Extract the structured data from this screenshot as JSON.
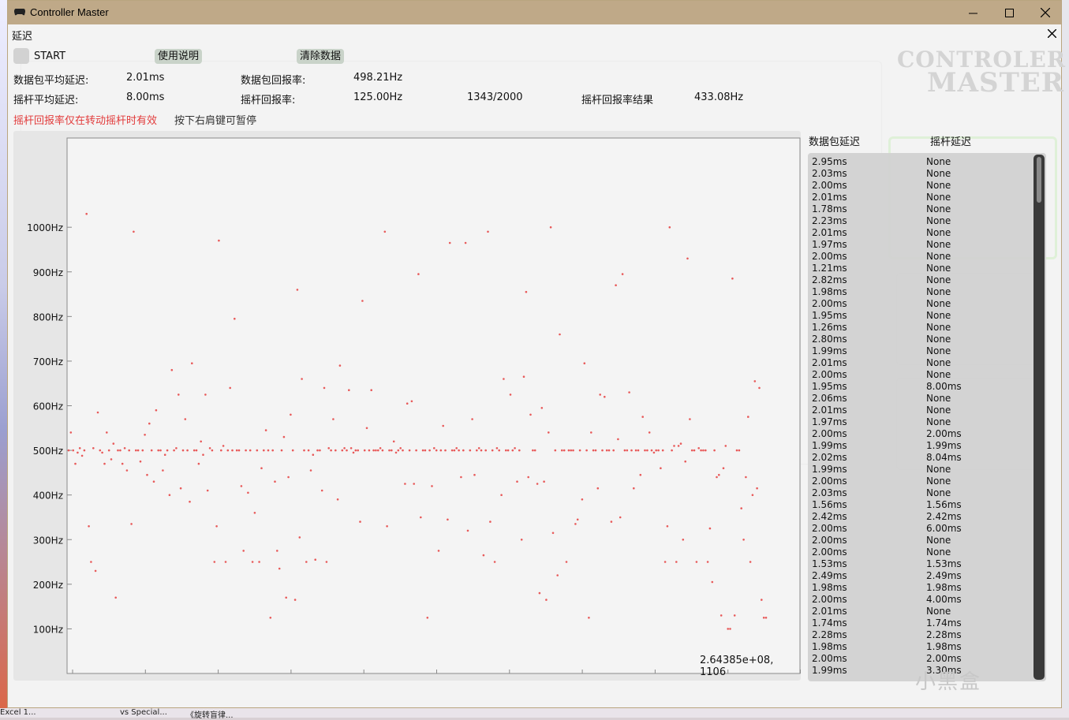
{
  "window": {
    "title": "Controller Master"
  },
  "dialog": {
    "label": "延迟"
  },
  "controls": {
    "start_label": "START",
    "usage_label": "使用说明",
    "clear_label": "清除数据"
  },
  "stats": {
    "packet_avg_latency_label": "数据包平均延迟:",
    "packet_avg_latency": "2.01ms",
    "packet_rate_label": "数据包回报率:",
    "packet_rate": "498.21Hz",
    "stick_avg_latency_label": "摇杆平均延迟:",
    "stick_avg_latency": "8.00ms",
    "stick_rate_label": "摇杆回报率:",
    "stick_rate": "125.00Hz",
    "progress": "1343/2000",
    "stick_result_label": "摇杆回报率结果",
    "stick_result": "433.08Hz"
  },
  "notice": {
    "warning": "摇杆回报率仅在转动摇杆时有效",
    "hint": "按下右肩键可暂停"
  },
  "ghost": {
    "logo_line1": "CONTROLER",
    "logo_line2": "MASTER"
  },
  "watermark": "小黑盒",
  "chart_data": {
    "type": "scatter",
    "ylabel": "",
    "y_ticks": [
      "1000Hz",
      "900Hz",
      "800Hz",
      "700Hz",
      "600Hz",
      "500Hz",
      "400Hz",
      "300Hz",
      "200Hz",
      "100Hz"
    ],
    "y_tick_values": [
      1000,
      900,
      800,
      700,
      600,
      500,
      400,
      300,
      200,
      100
    ],
    "ylim": [
      0,
      1200
    ],
    "cursor_readout": "2.64385e+08, 1106",
    "color": "#e85a5a",
    "points": [
      [
        0,
        500
      ],
      [
        1,
        540
      ],
      [
        2,
        500
      ],
      [
        3,
        470
      ],
      [
        4,
        495
      ],
      [
        5,
        505
      ],
      [
        6,
        488
      ],
      [
        7,
        500
      ],
      [
        8,
        1030
      ],
      [
        9,
        330
      ],
      [
        10,
        250
      ],
      [
        11,
        505
      ],
      [
        12,
        230
      ],
      [
        13,
        585
      ],
      [
        14,
        500
      ],
      [
        15,
        495
      ],
      [
        16,
        470
      ],
      [
        17,
        540
      ],
      [
        18,
        500
      ],
      [
        19,
        480
      ],
      [
        20,
        515
      ],
      [
        21,
        170
      ],
      [
        22,
        500
      ],
      [
        23,
        500
      ],
      [
        24,
        470
      ],
      [
        25,
        505
      ],
      [
        26,
        455
      ],
      [
        27,
        500
      ],
      [
        28,
        335
      ],
      [
        29,
        990
      ],
      [
        30,
        500
      ],
      [
        31,
        500
      ],
      [
        32,
        475
      ],
      [
        33,
        500
      ],
      [
        34,
        535
      ],
      [
        35,
        445
      ],
      [
        36,
        560
      ],
      [
        37,
        500
      ],
      [
        38,
        430
      ],
      [
        39,
        590
      ],
      [
        40,
        500
      ],
      [
        41,
        500
      ],
      [
        42,
        455
      ],
      [
        43,
        490
      ],
      [
        44,
        500
      ],
      [
        45,
        400
      ],
      [
        46,
        680
      ],
      [
        47,
        500
      ],
      [
        48,
        505
      ],
      [
        49,
        625
      ],
      [
        50,
        415
      ],
      [
        51,
        500
      ],
      [
        52,
        570
      ],
      [
        53,
        500
      ],
      [
        54,
        385
      ],
      [
        55,
        695
      ],
      [
        56,
        500
      ],
      [
        57,
        500
      ],
      [
        58,
        470
      ],
      [
        59,
        520
      ],
      [
        60,
        490
      ],
      [
        61,
        625
      ],
      [
        62,
        410
      ],
      [
        63,
        505
      ],
      [
        64,
        500
      ],
      [
        65,
        250
      ],
      [
        66,
        330
      ],
      [
        67,
        970
      ],
      [
        68,
        500
      ],
      [
        69,
        510
      ],
      [
        70,
        250
      ],
      [
        71,
        500
      ],
      [
        72,
        640
      ],
      [
        73,
        500
      ],
      [
        74,
        795
      ],
      [
        75,
        500
      ],
      [
        76,
        500
      ],
      [
        77,
        420
      ],
      [
        78,
        275
      ],
      [
        79,
        500
      ],
      [
        80,
        405
      ],
      [
        81,
        500
      ],
      [
        82,
        250
      ],
      [
        83,
        360
      ],
      [
        84,
        500
      ],
      [
        85,
        250
      ],
      [
        86,
        460
      ],
      [
        87,
        500
      ],
      [
        88,
        545
      ],
      [
        89,
        500
      ],
      [
        90,
        125
      ],
      [
        91,
        500
      ],
      [
        92,
        430
      ],
      [
        93,
        275
      ],
      [
        94,
        235
      ],
      [
        95,
        500
      ],
      [
        96,
        530
      ],
      [
        97,
        170
      ],
      [
        98,
        440
      ],
      [
        99,
        580
      ],
      [
        100,
        500
      ],
      [
        101,
        165
      ],
      [
        102,
        860
      ],
      [
        103,
        305
      ],
      [
        104,
        660
      ],
      [
        105,
        500
      ],
      [
        106,
        250
      ],
      [
        107,
        500
      ],
      [
        108,
        455
      ],
      [
        109,
        490
      ],
      [
        110,
        255
      ],
      [
        111,
        500
      ],
      [
        112,
        500
      ],
      [
        113,
        410
      ],
      [
        114,
        640
      ],
      [
        115,
        250
      ],
      [
        116,
        505
      ],
      [
        117,
        500
      ],
      [
        118,
        570
      ],
      [
        119,
        500
      ],
      [
        120,
        390
      ],
      [
        121,
        690
      ],
      [
        122,
        500
      ],
      [
        123,
        505
      ],
      [
        124,
        500
      ],
      [
        125,
        635
      ],
      [
        126,
        505
      ],
      [
        127,
        495
      ],
      [
        128,
        500
      ],
      [
        129,
        500
      ],
      [
        130,
        340
      ],
      [
        131,
        835
      ],
      [
        132,
        500
      ],
      [
        133,
        550
      ],
      [
        134,
        500
      ],
      [
        135,
        635
      ],
      [
        136,
        500
      ],
      [
        137,
        500
      ],
      [
        138,
        500
      ],
      [
        139,
        505
      ],
      [
        140,
        500
      ],
      [
        141,
        990
      ],
      [
        142,
        330
      ],
      [
        143,
        500
      ],
      [
        144,
        500
      ],
      [
        145,
        520
      ],
      [
        146,
        495
      ],
      [
        147,
        500
      ],
      [
        148,
        505
      ],
      [
        149,
        500
      ],
      [
        150,
        425
      ],
      [
        151,
        605
      ],
      [
        152,
        500
      ],
      [
        153,
        610
      ],
      [
        154,
        425
      ],
      [
        155,
        500
      ],
      [
        156,
        895
      ],
      [
        157,
        350
      ],
      [
        158,
        500
      ],
      [
        159,
        500
      ],
      [
        160,
        125
      ],
      [
        161,
        500
      ],
      [
        162,
        420
      ],
      [
        163,
        505
      ],
      [
        164,
        500
      ],
      [
        165,
        275
      ],
      [
        166,
        500
      ],
      [
        167,
        555
      ],
      [
        168,
        500
      ],
      [
        169,
        345
      ],
      [
        170,
        965
      ],
      [
        171,
        500
      ],
      [
        172,
        500
      ],
      [
        173,
        505
      ],
      [
        174,
        500
      ],
      [
        175,
        440
      ],
      [
        176,
        500
      ],
      [
        177,
        965
      ],
      [
        178,
        320
      ],
      [
        179,
        500
      ],
      [
        180,
        570
      ],
      [
        181,
        445
      ],
      [
        182,
        500
      ],
      [
        183,
        505
      ],
      [
        184,
        500
      ],
      [
        185,
        265
      ],
      [
        186,
        500
      ],
      [
        187,
        990
      ],
      [
        188,
        340
      ],
      [
        189,
        500
      ],
      [
        190,
        250
      ],
      [
        191,
        505
      ],
      [
        192,
        500
      ],
      [
        193,
        400
      ],
      [
        194,
        660
      ],
      [
        195,
        500
      ],
      [
        196,
        500
      ],
      [
        197,
        625
      ],
      [
        198,
        500
      ],
      [
        199,
        505
      ],
      [
        200,
        430
      ],
      [
        201,
        500
      ],
      [
        202,
        300
      ],
      [
        203,
        665
      ],
      [
        204,
        855
      ],
      [
        205,
        440
      ],
      [
        206,
        580
      ],
      [
        207,
        500
      ],
      [
        208,
        500
      ],
      [
        209,
        425
      ],
      [
        210,
        180
      ],
      [
        211,
        595
      ],
      [
        212,
        430
      ],
      [
        213,
        165
      ],
      [
        214,
        540
      ],
      [
        215,
        1000
      ],
      [
        216,
        315
      ],
      [
        217,
        500
      ],
      [
        218,
        220
      ],
      [
        219,
        760
      ],
      [
        220,
        500
      ],
      [
        221,
        500
      ],
      [
        222,
        250
      ],
      [
        223,
        500
      ],
      [
        224,
        500
      ],
      [
        225,
        500
      ],
      [
        226,
        335
      ],
      [
        227,
        345
      ],
      [
        228,
        500
      ],
      [
        229,
        390
      ],
      [
        230,
        695
      ],
      [
        231,
        500
      ],
      [
        232,
        125
      ],
      [
        233,
        540
      ],
      [
        234,
        500
      ],
      [
        235,
        500
      ],
      [
        236,
        415
      ],
      [
        237,
        625
      ],
      [
        238,
        500
      ],
      [
        239,
        620
      ],
      [
        240,
        500
      ],
      [
        241,
        500
      ],
      [
        242,
        340
      ],
      [
        243,
        500
      ],
      [
        244,
        870
      ],
      [
        245,
        525
      ],
      [
        246,
        350
      ],
      [
        247,
        895
      ],
      [
        248,
        500
      ],
      [
        249,
        500
      ],
      [
        250,
        630
      ],
      [
        251,
        500
      ],
      [
        252,
        415
      ],
      [
        253,
        500
      ],
      [
        254,
        500
      ],
      [
        255,
        445
      ],
      [
        256,
        575
      ],
      [
        257,
        500
      ],
      [
        258,
        500
      ],
      [
        259,
        540
      ],
      [
        260,
        500
      ],
      [
        261,
        495
      ],
      [
        262,
        500
      ],
      [
        263,
        500
      ],
      [
        264,
        460
      ],
      [
        265,
        500
      ],
      [
        266,
        250
      ],
      [
        267,
        330
      ],
      [
        268,
        1000
      ],
      [
        269,
        500
      ],
      [
        270,
        510
      ],
      [
        271,
        250
      ],
      [
        272,
        510
      ],
      [
        273,
        515
      ],
      [
        274,
        300
      ],
      [
        275,
        475
      ],
      [
        276,
        930
      ],
      [
        277,
        570
      ],
      [
        278,
        500
      ],
      [
        279,
        500
      ],
      [
        280,
        250
      ],
      [
        281,
        505
      ],
      [
        282,
        500
      ],
      [
        283,
        500
      ],
      [
        284,
        500
      ],
      [
        285,
        250
      ],
      [
        286,
        325
      ],
      [
        287,
        205
      ],
      [
        288,
        500
      ],
      [
        289,
        440
      ],
      [
        290,
        445
      ],
      [
        291,
        130
      ],
      [
        292,
        460
      ],
      [
        293,
        510
      ],
      [
        294,
        100
      ],
      [
        295,
        100
      ],
      [
        296,
        885
      ],
      [
        297,
        130
      ],
      [
        298,
        500
      ],
      [
        299,
        500
      ],
      [
        300,
        370
      ],
      [
        301,
        300
      ],
      [
        302,
        440
      ],
      [
        303,
        575
      ],
      [
        304,
        250
      ],
      [
        305,
        400
      ],
      [
        306,
        655
      ],
      [
        307,
        415
      ],
      [
        308,
        640
      ],
      [
        309,
        165
      ],
      [
        310,
        125
      ],
      [
        311,
        125
      ]
    ]
  },
  "lists": {
    "packet_header": "数据包延迟",
    "stick_header": "摇杆延迟",
    "packet": [
      "2.95ms",
      "2.03ms",
      "2.00ms",
      "2.01ms",
      "1.78ms",
      "2.23ms",
      "2.01ms",
      "1.97ms",
      "2.00ms",
      "1.21ms",
      "2.82ms",
      "1.98ms",
      "2.00ms",
      "1.95ms",
      "1.26ms",
      "2.80ms",
      "1.99ms",
      "2.01ms",
      "2.00ms",
      "1.95ms",
      "2.06ms",
      "2.01ms",
      "1.97ms",
      "2.00ms",
      "1.99ms",
      "2.02ms",
      "1.99ms",
      "2.00ms",
      "2.03ms",
      "1.56ms",
      "2.42ms",
      "2.00ms",
      "2.00ms",
      "2.00ms",
      "1.53ms",
      "2.49ms",
      "1.98ms",
      "2.00ms",
      "2.01ms",
      "1.74ms",
      "2.28ms",
      "1.98ms",
      "2.00ms",
      "1.99ms"
    ],
    "stick": [
      "None",
      "None",
      "None",
      "None",
      "None",
      "None",
      "None",
      "None",
      "None",
      "None",
      "None",
      "None",
      "None",
      "None",
      "None",
      "None",
      "None",
      "None",
      "None",
      "8.00ms",
      "None",
      "None",
      "None",
      "2.00ms",
      "1.99ms",
      "8.04ms",
      "None",
      "None",
      "None",
      "1.56ms",
      "2.42ms",
      "6.00ms",
      "None",
      "None",
      "1.53ms",
      "2.49ms",
      "1.98ms",
      "4.00ms",
      "None",
      "1.74ms",
      "2.28ms",
      "1.98ms",
      "2.00ms",
      "3.30ms"
    ]
  },
  "taskbar": {
    "item1": "Excel 1...",
    "item2": "vs Special...",
    "item3": "《旋转盲律..."
  }
}
